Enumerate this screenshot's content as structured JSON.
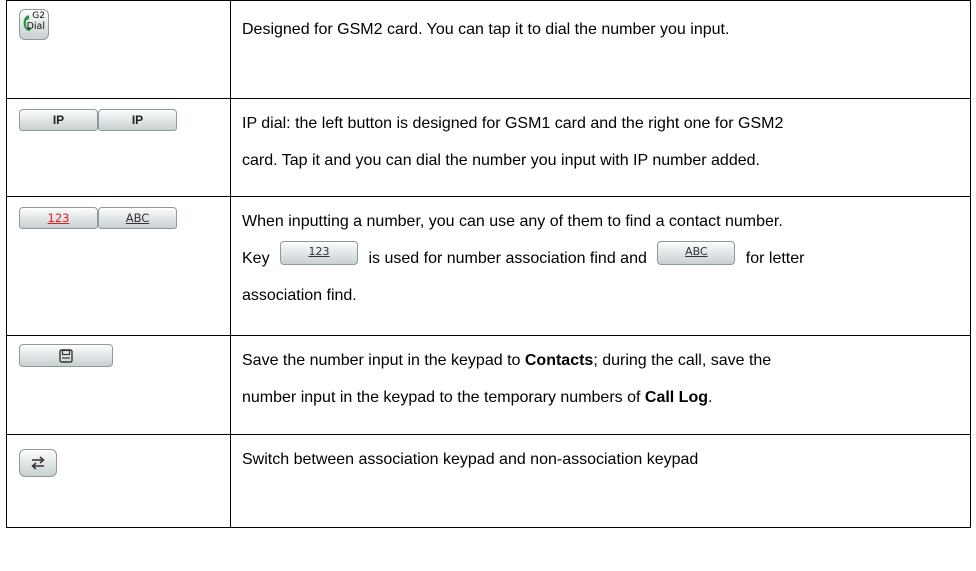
{
  "rows": [
    {
      "icon": {
        "name": "g2-dial-button",
        "line1": "G2",
        "line2": "Dial"
      },
      "text": "Designed for GSM2 card. You can tap it to dial the number you input."
    },
    {
      "icons": [
        {
          "label": "IP"
        },
        {
          "label": "IP"
        }
      ],
      "line1": "IP dial: the left button is designed for GSM1 card and the right one for GSM2",
      "line2": "card. Tap it and you can dial the number you input with IP number added."
    },
    {
      "icons": [
        {
          "label": "123"
        },
        {
          "label": "ABC"
        }
      ],
      "line1": "When inputting a number, you can use any of them to find a contact number.",
      "line2_prefix": "Key",
      "key1_label": "123",
      "line2_middle": "is used for number association find and",
      "key2_label": "ABC",
      "line2_suffix": "for letter",
      "line3": "association find."
    },
    {
      "icon": {
        "name": "save-icon"
      },
      "line1_a": "Save the number input in the keypad to ",
      "line1_bold": "Contacts",
      "line1_b": "; during the call, save the",
      "line2_a": "number input in the keypad to the temporary numbers of ",
      "line2_bold": "Call Log",
      "line2_b": "."
    },
    {
      "icon": {
        "name": "switch-arrows-icon"
      },
      "text": "Switch between association keypad and non-association keypad"
    }
  ],
  "colors": {
    "number_key_text": "#e0201c",
    "border": "#000000"
  }
}
